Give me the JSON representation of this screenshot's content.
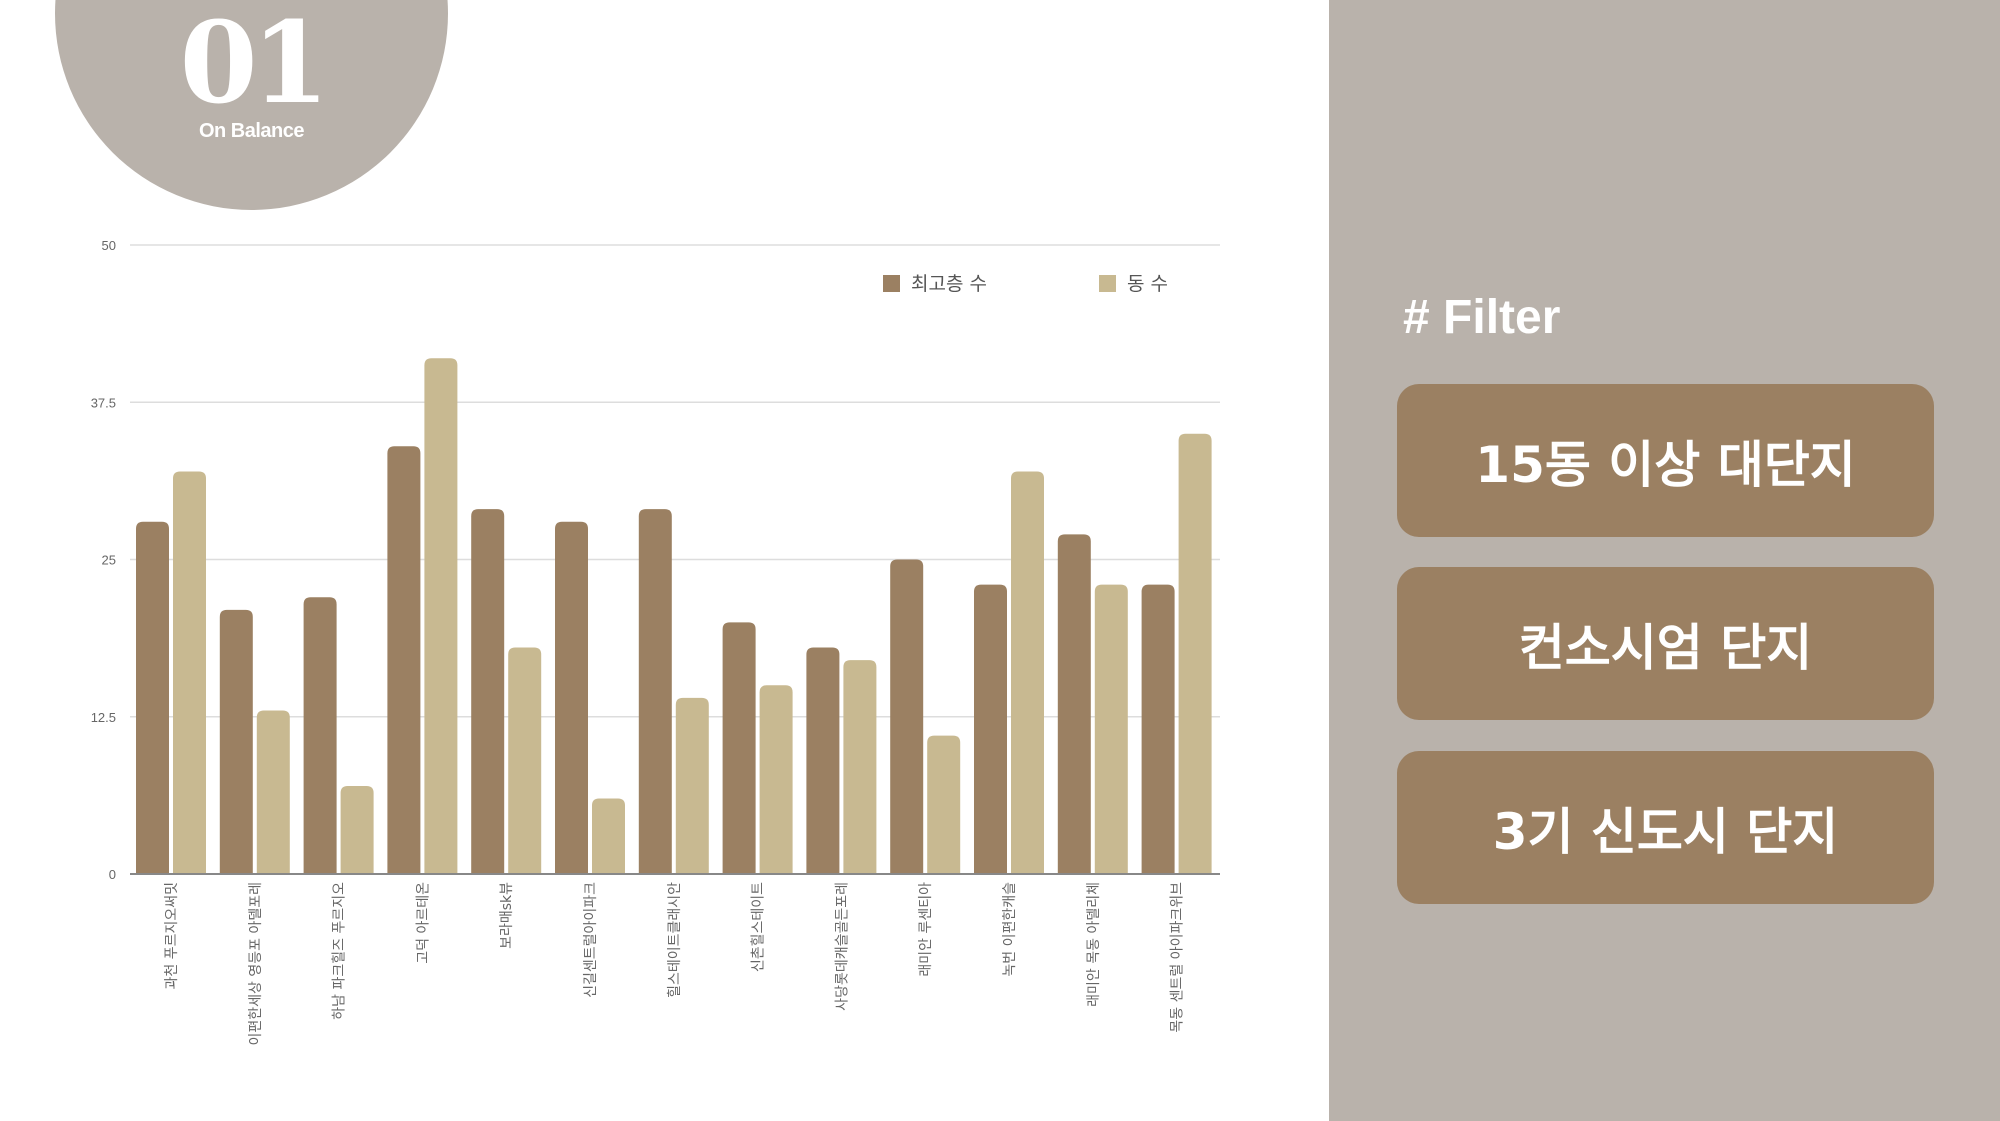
{
  "badge": {
    "number": "01",
    "subtitle": "On Balance"
  },
  "colors": {
    "series1": "#9b8062",
    "series2": "#c8b991",
    "panel": "#b9b2ab",
    "button": "#9b8062",
    "grid": "#dddddd",
    "axis_text": "#666666"
  },
  "chart_data": {
    "type": "bar",
    "ylim": [
      0,
      50
    ],
    "yticks": [
      "0",
      "12.5",
      "25",
      "37.5",
      "50"
    ],
    "grid": true,
    "legend_position": "top-right",
    "categories": [
      "과천 푸르지오써밋",
      "이편한세상 영등포 아델포레",
      "하남 파크힐즈 푸르지오",
      "고덕 아르테온",
      "보라매sk뷰",
      "신길센트럴아이파크",
      "힐스테이트클래시안",
      "신촌힐스테이트",
      "사당롯데캐슬골든포레",
      "래미안 루센티아",
      "녹번 이편한캐슬",
      "래미안 목동 아델리체",
      "목동 센트럴 아이파크위브"
    ],
    "series": [
      {
        "name": "최고층 수",
        "values": [
          28,
          21,
          22,
          34,
          29,
          28,
          29,
          20,
          18,
          25,
          23,
          27,
          23
        ]
      },
      {
        "name": "동 수",
        "values": [
          32,
          13,
          7,
          41,
          18,
          6,
          14,
          15,
          17,
          11,
          32,
          23,
          35
        ]
      }
    ]
  },
  "filter": {
    "title": "# Filter",
    "buttons": [
      "15동 이상 대단지",
      "컨소시엄 단지",
      "3기 신도시 단지"
    ]
  }
}
